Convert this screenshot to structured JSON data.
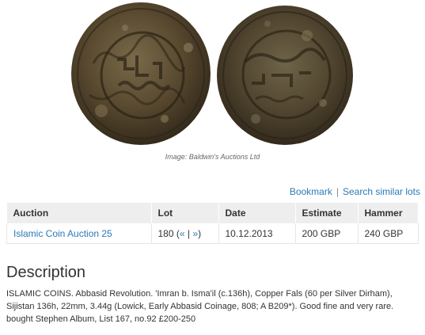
{
  "image_credit": "Image: Baldwin's Auctions Ltd",
  "actions": {
    "bookmark": "Bookmark",
    "separator": "|",
    "search_similar": "Search similar lots"
  },
  "table": {
    "headers": [
      "Auction",
      "Lot",
      "Date",
      "Estimate",
      "Hammer"
    ],
    "row": {
      "auction": "Islamic Coin Auction 25",
      "lot": "180",
      "lot_nav_open": "(",
      "lot_prev": "«",
      "lot_nav_sep": "|",
      "lot_next": "»",
      "lot_nav_close": ")",
      "date": "10.12.2013",
      "estimate": "200 GBP",
      "hammer": "240 GBP"
    }
  },
  "description": {
    "heading": "Description",
    "text": "ISLAMIC COINS. Abbasid Revolution. 'Imran b. Isma'il (c.136h), Copper Fals (60 per Silver Dirham), Sijistan 136h, 22mm, 3.44g (Lowick, Early Abbasid Coinage, 808; A B209*). Good fine and very rare. bought Stephen Album, List 167, no.92 £200-250"
  },
  "colors": {
    "link": "#2a7ab8",
    "header_bg": "#eeeeee",
    "coin_dark": "#3f3422",
    "coin_mid": "#6b5a3c",
    "coin_light": "#8a7a58"
  }
}
